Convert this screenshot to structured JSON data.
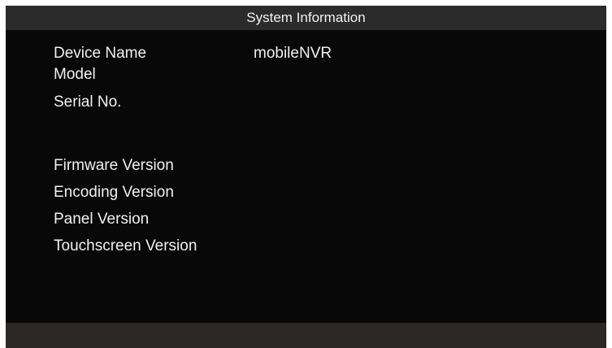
{
  "window": {
    "title": "System Information"
  },
  "info": {
    "rows": [
      {
        "label": "Device Name",
        "value": "mobileNVR"
      },
      {
        "label": "Model",
        "value": ""
      },
      {
        "label": "Serial No.",
        "value": ""
      },
      {
        "label": "Firmware Version",
        "value": ""
      },
      {
        "label": "Encoding Version",
        "value": ""
      },
      {
        "label": "Panel Version",
        "value": ""
      },
      {
        "label": "Touchscreen Version",
        "value": ""
      }
    ]
  },
  "colors": {
    "background": "#080808",
    "title_bar": "#2b2b2b",
    "footer_bar": "#2d2828",
    "text": "#f0f0f0"
  }
}
